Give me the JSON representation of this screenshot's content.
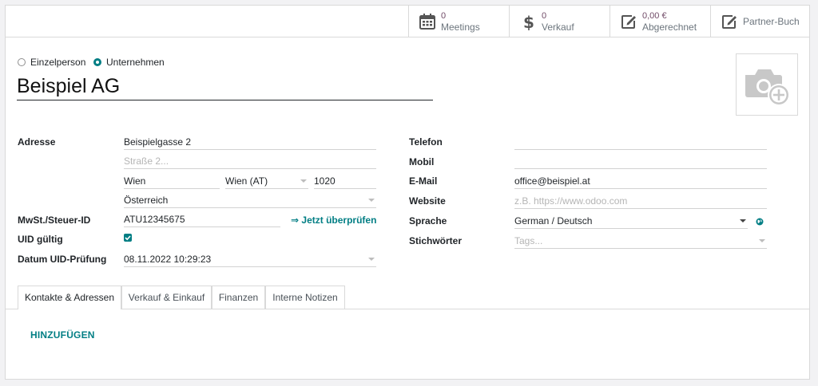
{
  "smart_buttons": {
    "meetings": {
      "value": "0",
      "label": "Meetings",
      "icon": "calendar-icon"
    },
    "sales": {
      "value": "0",
      "label": "Verkauf",
      "icon": "dollar-icon"
    },
    "invoiced": {
      "value": "0,00 €",
      "label": "Abgerechnet",
      "icon": "edit-icon"
    },
    "ledger": {
      "label": "Partner-Buch",
      "icon": "edit-icon"
    }
  },
  "company_type": {
    "individual": "Einzelperson",
    "company": "Unternehmen",
    "selected": "Unternehmen"
  },
  "name": "Beispiel AG",
  "address": {
    "label": "Adresse",
    "street": "Beispielgasse 2",
    "street2_placeholder": "Straße 2...",
    "city": "Wien",
    "state": "Wien (AT)",
    "zip": "1020",
    "country": "Österreich"
  },
  "vat": {
    "label": "MwSt./Steuer-ID",
    "value": "ATU12345675",
    "check_link": "⇒ Jetzt überprüfen"
  },
  "uid_valid": {
    "label": "UID gültig",
    "checked": true
  },
  "uid_check_date": {
    "label": "Datum UID-Prüfung",
    "value": "08.11.2022 10:29:23"
  },
  "contact": {
    "phone_label": "Telefon",
    "phone": "",
    "mobile_label": "Mobil",
    "mobile": "",
    "email_label": "E-Mail",
    "email": "office@beispiel.at",
    "website_label": "Website",
    "website_placeholder": "z.B. https://www.odoo.com",
    "language_label": "Sprache",
    "language": "German / Deutsch",
    "tags_label": "Stichwörter",
    "tags_placeholder": "Tags..."
  },
  "tabs": [
    {
      "label": "Kontakte & Adressen",
      "active": true
    },
    {
      "label": "Verkauf & Einkauf",
      "active": false
    },
    {
      "label": "Finanzen",
      "active": false
    },
    {
      "label": "Interne Notizen",
      "active": false
    }
  ],
  "add_button": "HINZUFÜGEN",
  "colors": {
    "accent": "#017e84",
    "brand": "#714B67"
  }
}
